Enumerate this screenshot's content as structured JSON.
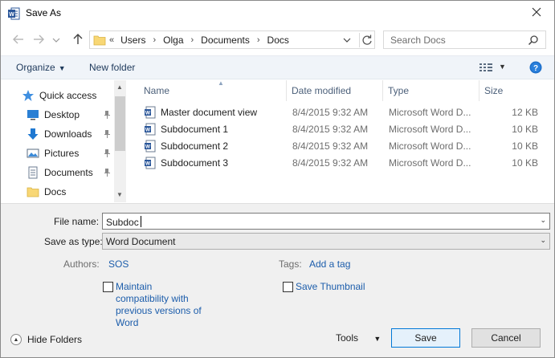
{
  "window": {
    "title": "Save As"
  },
  "address_bar": {
    "overflow": "«",
    "crumbs": [
      "Users",
      "Olga",
      "Documents",
      "Docs"
    ]
  },
  "search": {
    "placeholder": "Search Docs"
  },
  "toolbar": {
    "organize_label": "Organize",
    "new_folder_label": "New folder"
  },
  "nav_pane": {
    "items": [
      {
        "label": "Quick access",
        "icon": "star-icon",
        "pinned": false
      },
      {
        "label": "Desktop",
        "icon": "desktop-icon",
        "pinned": true
      },
      {
        "label": "Downloads",
        "icon": "download-icon",
        "pinned": true
      },
      {
        "label": "Pictures",
        "icon": "pictures-icon",
        "pinned": true
      },
      {
        "label": "Documents",
        "icon": "documents-icon",
        "pinned": true
      },
      {
        "label": "Docs",
        "icon": "folder-icon",
        "pinned": false
      }
    ]
  },
  "file_list": {
    "columns": [
      "Name",
      "Date modified",
      "Type",
      "Size"
    ],
    "rows": [
      {
        "name": "Master document view",
        "date": "8/4/2015 9:32 AM",
        "type": "Microsoft Word D...",
        "size": "12 KB"
      },
      {
        "name": "Subdocument 1",
        "date": "8/4/2015 9:32 AM",
        "type": "Microsoft Word D...",
        "size": "10 KB"
      },
      {
        "name": "Subdocument 2",
        "date": "8/4/2015 9:32 AM",
        "type": "Microsoft Word D...",
        "size": "10 KB"
      },
      {
        "name": "Subdocument 3",
        "date": "8/4/2015 9:32 AM",
        "type": "Microsoft Word D...",
        "size": "10 KB"
      }
    ]
  },
  "form": {
    "file_name_label": "File name:",
    "file_name_value": "Subdoc",
    "save_type_label": "Save as type:",
    "save_type_value": "Word Document",
    "authors_label": "Authors:",
    "authors_value": "SOS",
    "tags_label": "Tags:",
    "tags_value": "Add a tag",
    "compat_label_lines": [
      "Maintain",
      "compatibility with",
      "previous versions of",
      "Word"
    ],
    "thumbnail_label": "Save Thumbnail"
  },
  "footer": {
    "hide_folders_label": "Hide Folders",
    "tools_label": "Tools",
    "save_label": "Save",
    "cancel_label": "Cancel"
  },
  "colors": {
    "accent": "#0078d7",
    "link": "#1c5dab",
    "word_blue": "#2b579a",
    "folder_yellow": "#f8d775"
  }
}
